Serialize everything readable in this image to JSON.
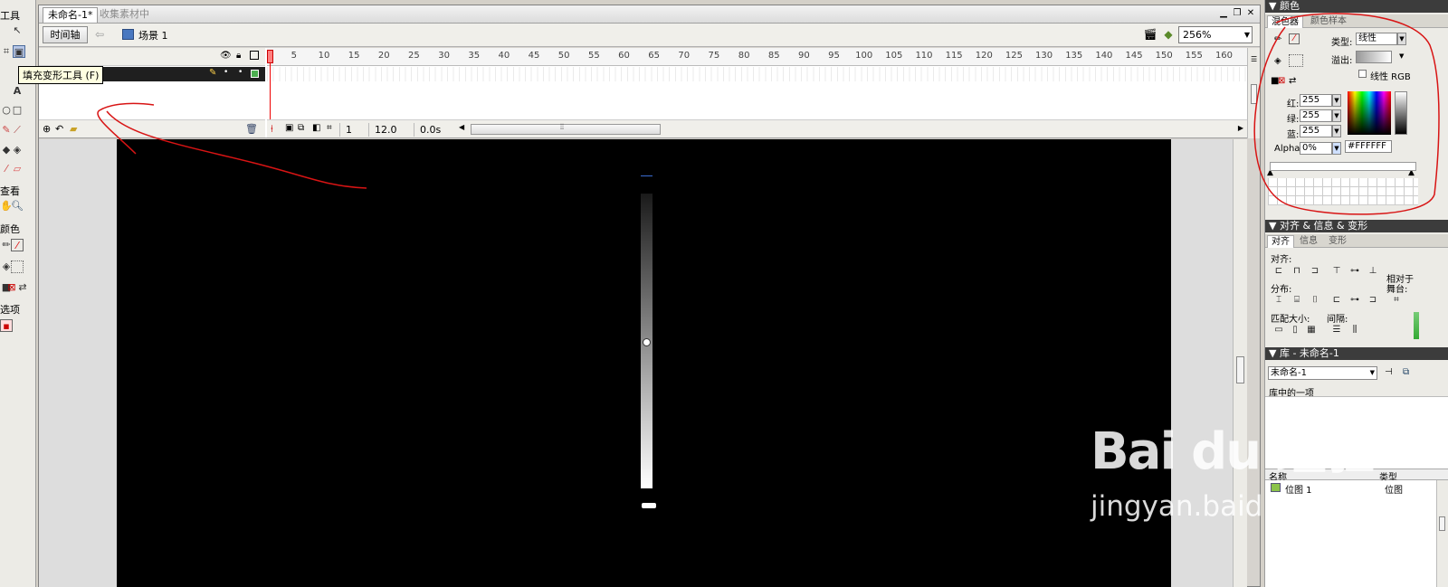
{
  "tools": {
    "title": "工具",
    "view_label": "查看",
    "color_label": "颜色",
    "options_label": "选项",
    "tooltip": "填充变形工具 (F)"
  },
  "document": {
    "tab_active": "未命名-1*",
    "tab_inactive": "收集素材中",
    "timeline_button": "时间轴",
    "scene_label": "场景 1",
    "zoom": "256%"
  },
  "timeline": {
    "ruler": [
      "5",
      "10",
      "15",
      "20",
      "25",
      "30",
      "35",
      "40",
      "45",
      "50",
      "55",
      "60",
      "65",
      "70",
      "75",
      "80",
      "85",
      "90",
      "95",
      "100",
      "105",
      "110",
      "115",
      "120",
      "125",
      "130",
      "135",
      "140",
      "145",
      "150",
      "155",
      "160"
    ],
    "current_frame": "1",
    "fps": "12.0 fps",
    "time": "0.0s"
  },
  "color_panel": {
    "title": "颜色",
    "tab_mixer": "混色器",
    "tab_swatches": "颜色样本",
    "type_label": "类型:",
    "type_value": "线性",
    "overflow_label": "溢出:",
    "linear_rgb": "线性 RGB",
    "red_label": "红:",
    "red": "255",
    "green_label": "绿:",
    "green": "255",
    "blue_label": "蓝:",
    "blue": "255",
    "alpha_label": "Alpha:",
    "alpha": "0%",
    "hex": "#FFFFFF"
  },
  "align_panel": {
    "title": "对齐 & 信息 & 变形",
    "tab_align": "对齐",
    "tab_info": "信息",
    "tab_transform": "变形",
    "align_label": "对齐:",
    "distribute_label": "分布:",
    "match_size_label": "匹配大小:",
    "spacing_label": "间隔:",
    "relative_label_1": "相对于",
    "relative_label_2": "舞台:"
  },
  "library_panel": {
    "title": "库 - 未命名-1",
    "selected": "未命名-1",
    "item_count": "库中的一项",
    "col_name": "名称",
    "col_type": "类型",
    "item_name": "位图 1",
    "item_type": "位图"
  },
  "watermark": {
    "logo": "Bai du 经验",
    "url": "jingyan.baidu.com"
  }
}
